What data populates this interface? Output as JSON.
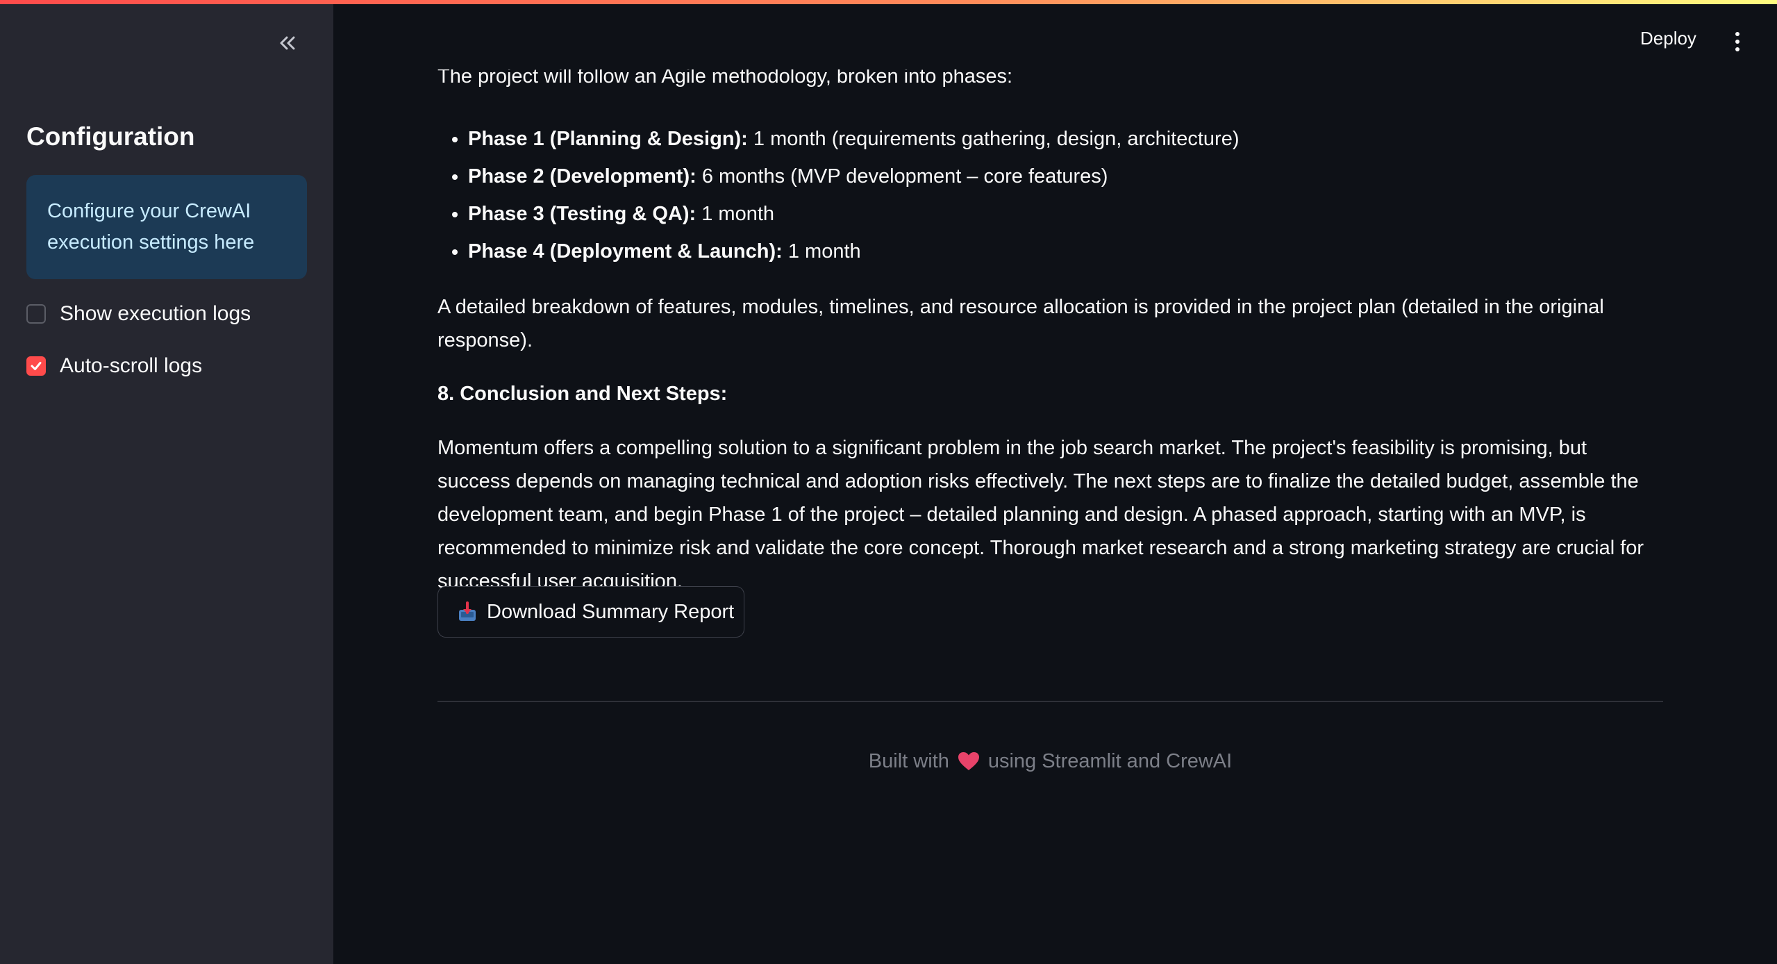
{
  "header": {
    "deploy_label": "Deploy",
    "menu_icon": "kebab-menu-icon"
  },
  "sidebar": {
    "collapse_icon": "double-chevron-left-icon",
    "title": "Configuration",
    "info_text": "Configure your CrewAI execution settings here",
    "checkboxes": [
      {
        "label": "Show execution logs",
        "checked": false
      },
      {
        "label": "Auto-scroll logs",
        "checked": true
      }
    ]
  },
  "main": {
    "intro_text": "The project will follow an Agile methodology, broken into phases:",
    "phases": [
      {
        "title": "Phase 1 (Planning & Design):",
        "detail": " 1 month (requirements gathering, design, architecture)"
      },
      {
        "title": "Phase 2 (Development):",
        "detail": " 6 months (MVP development – core features)"
      },
      {
        "title": "Phase 3 (Testing & QA):",
        "detail": " 1 month"
      },
      {
        "title": "Phase 4 (Deployment & Launch):",
        "detail": " 1 month"
      }
    ],
    "breakdown_text": "A detailed breakdown of features, modules, timelines, and resource allocation is provided in the project plan (detailed in the original response).",
    "section_heading": "8. Conclusion and Next Steps:",
    "conclusion_text": "Momentum offers a compelling solution to a significant problem in the job search market. The project's feasibility is promising, but success depends on managing technical and adoption risks effectively. The next steps are to finalize the detailed budget, assemble the development team, and begin Phase 1 of the project – detailed planning and design. A phased approach, starting with an MVP, is recommended to minimize risk and validate the core concept. Thorough market research and a strong marketing strategy are crucial for successful user acquisition.",
    "download_label": "Download Summary Report",
    "download_icon": "inbox-tray-icon"
  },
  "footer": {
    "text_before": "Built with",
    "heart_icon": "heart-icon",
    "text_after": "using Streamlit and CrewAI"
  },
  "colors": {
    "accent": "#ff4b4b",
    "background": "#0e1117",
    "sidebar": "#262730",
    "info_box": "#1c3a55",
    "info_text": "#c7ebff"
  }
}
